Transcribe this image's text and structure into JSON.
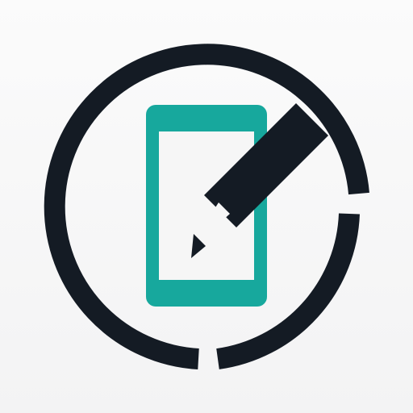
{
  "icon": {
    "name": "phone-edit-icon",
    "colors": {
      "background": "#f6f6f6",
      "ring": "#141b24",
      "phone": "#17a89d",
      "pencil": "#141b24"
    }
  }
}
